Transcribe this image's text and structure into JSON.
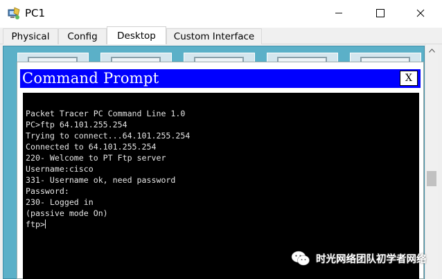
{
  "window": {
    "title": "PC1",
    "icon": "pc-app-icon",
    "controls": [
      "minimize-icon",
      "maximize-icon",
      "close-icon"
    ]
  },
  "tabs": [
    {
      "label": "Physical",
      "active": false
    },
    {
      "label": "Config",
      "active": false
    },
    {
      "label": "Desktop",
      "active": true
    },
    {
      "label": "Custom Interface",
      "active": false
    }
  ],
  "command_prompt": {
    "title": "Command Prompt",
    "close_label": "X",
    "lines": [
      "Packet Tracer PC Command Line 1.0",
      "PC>ftp 64.101.255.254",
      "Trying to connect...64.101.255.254",
      "Connected to 64.101.255.254",
      "220- Welcome to PT Ftp server",
      "Username:cisco",
      "331- Username ok, need password",
      "Password:",
      "230- Logged in",
      "(passive mode On)"
    ],
    "prompt": "ftp>"
  },
  "watermark": {
    "text": "时光网络团队初学者网络",
    "icon": "wechat-logo"
  },
  "colors": {
    "desktop_bg": "#5bb0c8",
    "cmd_titlebar": "#0000ff",
    "console_bg": "#000000",
    "console_text": "#e6e6e6"
  }
}
